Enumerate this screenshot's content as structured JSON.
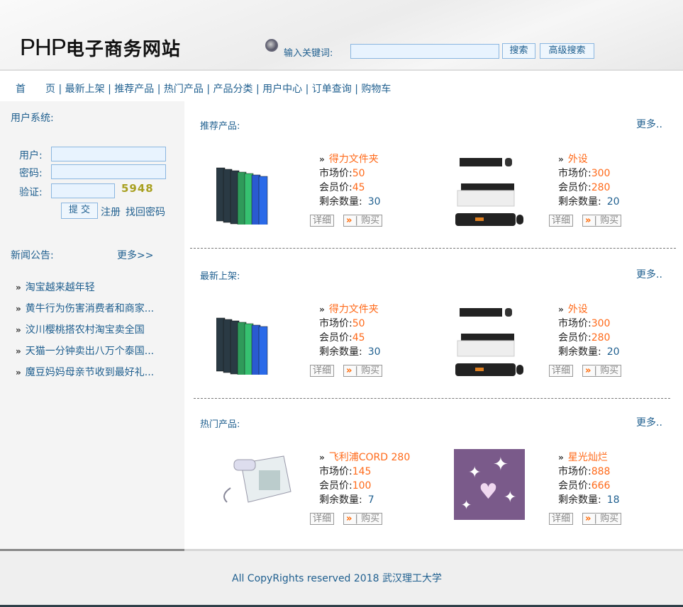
{
  "header": {
    "logo_latin": "PHP",
    "logo_cn": "电子商务网站",
    "keyword_label": "输入关键词:",
    "search_value": "",
    "search_button": "搜索",
    "advanced_button": "高级搜索"
  },
  "nav": [
    "首　　页",
    "最新上架",
    "推荐产品",
    "热门产品",
    "产品分类",
    "用户中心",
    "订单查询",
    "购物车"
  ],
  "sidebar": {
    "user_title": "用户系统:",
    "user_label": "用户:",
    "pwd_label": "密码:",
    "verify_label": "验证:",
    "captcha": "5948",
    "submit": "提 交",
    "register": "注册",
    "forgot": "找回密码",
    "news_title": "新闻公告:",
    "news_more": "更多>>",
    "news": [
      "淘宝越来越年轻",
      "黄牛行为伤害消费者和商家...",
      "汶川樱桃搭农村淘宝卖全国",
      "天猫一分钟卖出八万个泰国...",
      "魔豆妈妈母亲节收到最好礼..."
    ]
  },
  "labels": {
    "market": "市场价:",
    "member": "会员价:",
    "stock": "剩余数量:",
    "detail": "详细",
    "buy": "购买",
    "more": "更多.."
  },
  "sections": [
    {
      "title": "推荐产品:",
      "products": [
        {
          "name": "得力文件夹",
          "market": "50",
          "member": "45",
          "stock": "30",
          "image": "folders"
        },
        {
          "name": "外设",
          "market": "300",
          "member": "280",
          "stock": "20",
          "image": "keyboards"
        }
      ]
    },
    {
      "title": "最新上架:",
      "products": [
        {
          "name": "得力文件夹",
          "market": "50",
          "member": "45",
          "stock": "30",
          "image": "folders"
        },
        {
          "name": "外设",
          "market": "300",
          "member": "280",
          "stock": "20",
          "image": "keyboards"
        }
      ]
    },
    {
      "title": "热门产品:",
      "products": [
        {
          "name": "飞利浦CORD 280",
          "market": "145",
          "member": "100",
          "stock": "7",
          "image": "phone"
        },
        {
          "name": "星光灿烂",
          "market": "888",
          "member": "666",
          "stock": "18",
          "image": "sparkle"
        }
      ]
    }
  ],
  "footer": "All CopyRights reserved 2018 武汉理工大学"
}
